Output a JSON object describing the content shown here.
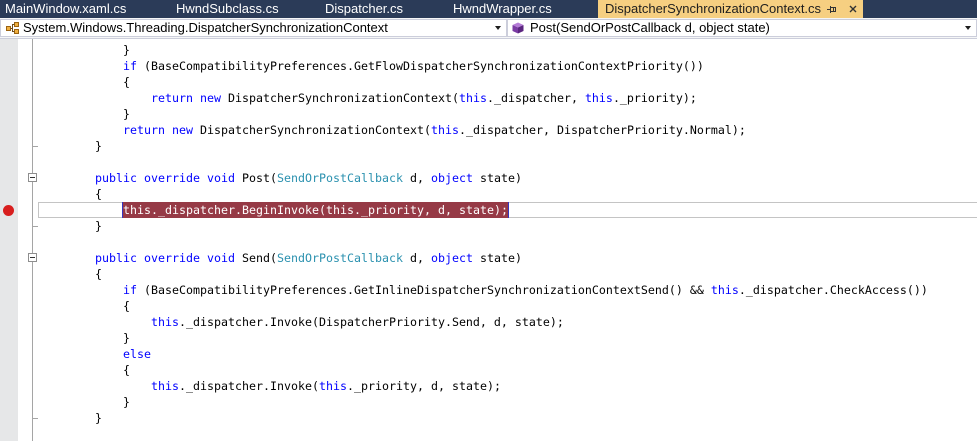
{
  "colors": {
    "tab_bar_bg": "#2B3B58",
    "tab_text": "#FFFFFF",
    "active_tab_bg": "#F6CF81",
    "active_tab_text": "#1E1E1E",
    "indicator_margin": "#E6E7E8",
    "outline_line": "#A5A5A5",
    "keyword": "#0000FF",
    "type": "#2B91AF",
    "plain": "#000000",
    "breakpoint_highlight": "#963A46",
    "breakpoint_border": "#3535C0",
    "breakpoint_text": "#FFFFFF",
    "breakpoint_dot": "#D81E1E"
  },
  "tabs": [
    {
      "label": "MainWindow.xaml.cs",
      "active": false
    },
    {
      "label": "HwndSubclass.cs",
      "active": false
    },
    {
      "label": "Dispatcher.cs",
      "active": false
    },
    {
      "label": "HwndWrapper.cs",
      "active": false
    },
    {
      "label": "DispatcherSynchronizationContext.cs",
      "active": true
    }
  ],
  "active_tab_icons": {
    "pin": "pin-icon",
    "close": "close-icon"
  },
  "navbar": {
    "type_dropdown": {
      "value": "System.Windows.Threading.DispatcherSynchronizationContext",
      "icon": "class-icon"
    },
    "member_dropdown": {
      "value": "Post(SendOrPostCallback d, object state)",
      "icon": "method-icon"
    }
  },
  "code": {
    "lines": [
      {
        "indent": "            ",
        "tokens": [
          {
            "text": "}"
          }
        ]
      },
      {
        "indent": "            ",
        "tokens": [
          {
            "kw": "if"
          },
          {
            "text": " (BaseCompatibilityPreferences.GetFlowDispatcherSynchronizationContextPriority())"
          }
        ]
      },
      {
        "indent": "            ",
        "tokens": [
          {
            "text": "{"
          }
        ]
      },
      {
        "indent": "                ",
        "tokens": [
          {
            "kw": "return"
          },
          {
            "text": " "
          },
          {
            "kw": "new"
          },
          {
            "text": " DispatcherSynchronizationContext("
          },
          {
            "kw": "this"
          },
          {
            "text": "._dispatcher, "
          },
          {
            "kw": "this"
          },
          {
            "text": "._priority);"
          }
        ]
      },
      {
        "indent": "            ",
        "tokens": [
          {
            "text": "}"
          }
        ]
      },
      {
        "indent": "            ",
        "tokens": [
          {
            "kw": "return"
          },
          {
            "text": " "
          },
          {
            "kw": "new"
          },
          {
            "text": " DispatcherSynchronizationContext("
          },
          {
            "kw": "this"
          },
          {
            "text": "._dispatcher, DispatcherPriority.Normal);"
          }
        ]
      },
      {
        "indent": "        ",
        "tokens": [
          {
            "text": "}"
          }
        ],
        "block_end": true
      },
      {
        "indent": "",
        "tokens": []
      },
      {
        "indent": "        ",
        "tokens": [
          {
            "kw": "public"
          },
          {
            "text": " "
          },
          {
            "kw": "override"
          },
          {
            "text": " "
          },
          {
            "kw": "void"
          },
          {
            "text": " Post("
          },
          {
            "type": "SendOrPostCallback"
          },
          {
            "text": " d, "
          },
          {
            "kw": "object"
          },
          {
            "text": " state)"
          }
        ],
        "collapsible": true
      },
      {
        "indent": "        ",
        "tokens": [
          {
            "text": "{"
          }
        ]
      },
      {
        "indent": "            ",
        "tokens": [
          {
            "kw": "this"
          },
          {
            "text": "._dispatcher.BeginInvoke("
          },
          {
            "kw": "this"
          },
          {
            "text": "._priority, d, state);"
          }
        ],
        "breakpoint": true,
        "current": true
      },
      {
        "indent": "        ",
        "tokens": [
          {
            "text": "}"
          }
        ],
        "block_end": true
      },
      {
        "indent": "",
        "tokens": []
      },
      {
        "indent": "        ",
        "tokens": [
          {
            "kw": "public"
          },
          {
            "text": " "
          },
          {
            "kw": "override"
          },
          {
            "text": " "
          },
          {
            "kw": "void"
          },
          {
            "text": " Send("
          },
          {
            "type": "SendOrPostCallback"
          },
          {
            "text": " d, "
          },
          {
            "kw": "object"
          },
          {
            "text": " state)"
          }
        ],
        "collapsible": true
      },
      {
        "indent": "        ",
        "tokens": [
          {
            "text": "{"
          }
        ]
      },
      {
        "indent": "            ",
        "tokens": [
          {
            "kw": "if"
          },
          {
            "text": " (BaseCompatibilityPreferences.GetInlineDispatcherSynchronizationContextSend() && "
          },
          {
            "kw": "this"
          },
          {
            "text": "._dispatcher.CheckAccess())"
          }
        ]
      },
      {
        "indent": "            ",
        "tokens": [
          {
            "text": "{"
          }
        ]
      },
      {
        "indent": "                ",
        "tokens": [
          {
            "kw": "this"
          },
          {
            "text": "._dispatcher.Invoke(DispatcherPriority.Send, d, state);"
          }
        ]
      },
      {
        "indent": "            ",
        "tokens": [
          {
            "text": "}"
          }
        ]
      },
      {
        "indent": "            ",
        "tokens": [
          {
            "kw": "else"
          }
        ]
      },
      {
        "indent": "            ",
        "tokens": [
          {
            "text": "{"
          }
        ]
      },
      {
        "indent": "                ",
        "tokens": [
          {
            "kw": "this"
          },
          {
            "text": "._dispatcher.Invoke("
          },
          {
            "kw": "this"
          },
          {
            "text": "._priority, d, state);"
          }
        ]
      },
      {
        "indent": "            ",
        "tokens": [
          {
            "text": "}"
          }
        ]
      },
      {
        "indent": "        ",
        "tokens": [
          {
            "text": "}"
          }
        ],
        "block_end": true
      }
    ]
  }
}
